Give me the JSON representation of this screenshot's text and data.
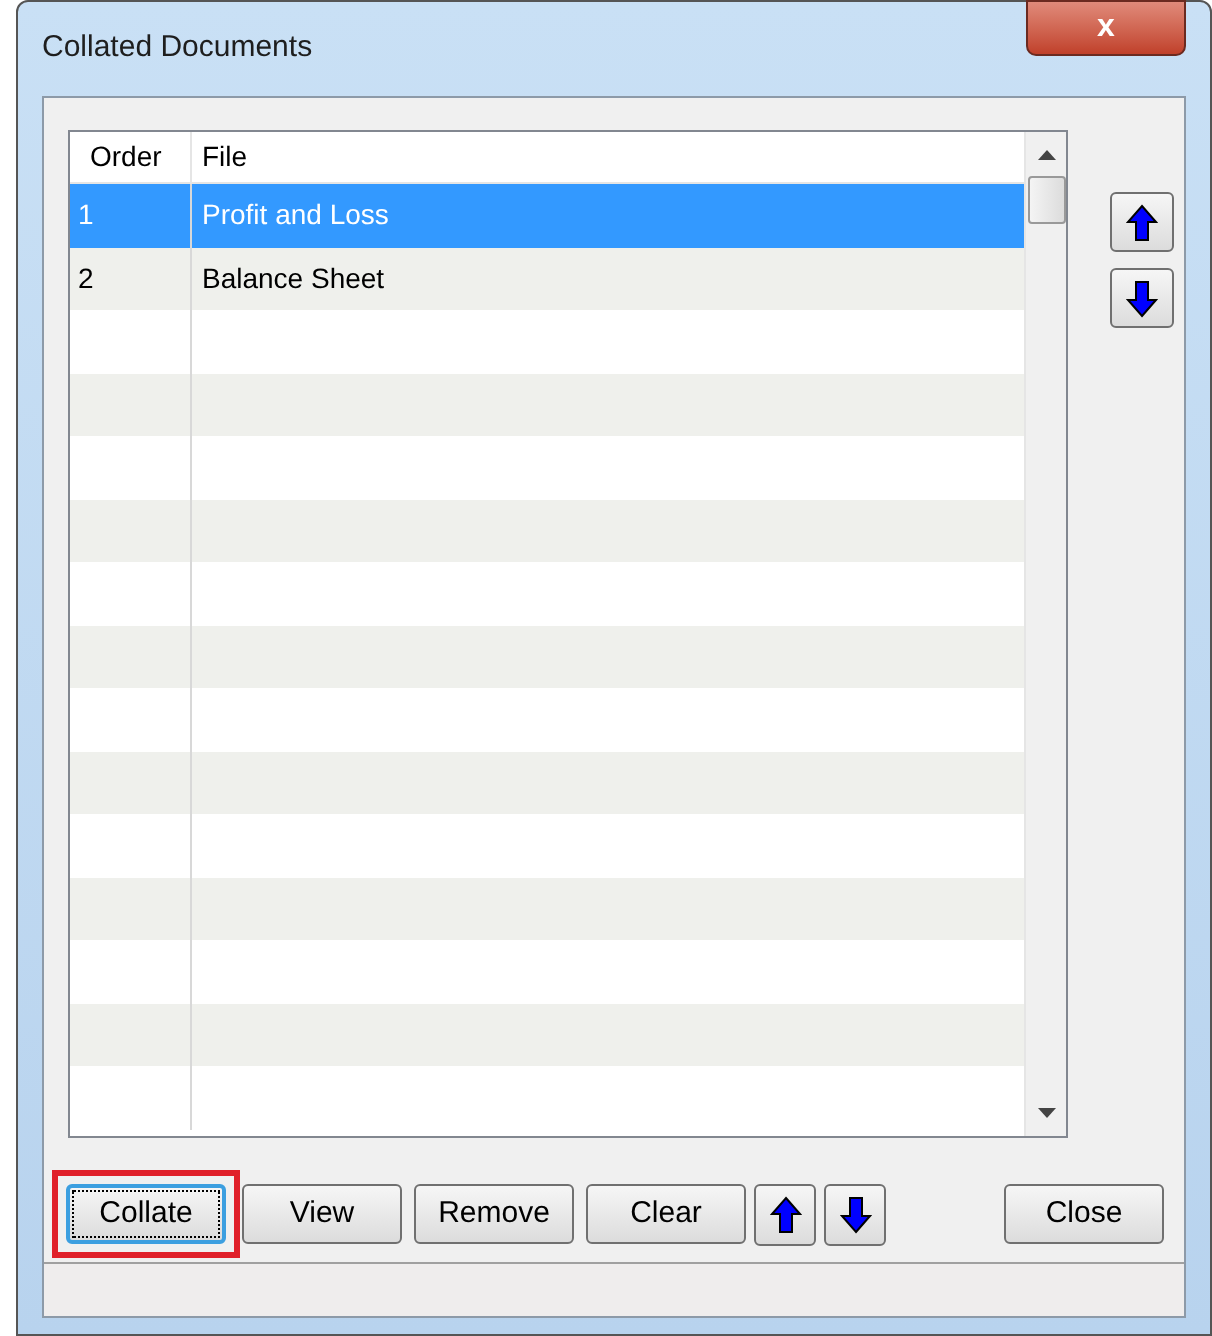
{
  "window": {
    "title": "Collated Documents",
    "close_symbol": "x"
  },
  "table": {
    "columns": [
      "Order",
      "File"
    ],
    "rows": [
      {
        "cells": [
          "1",
          "Profit and Loss"
        ],
        "selected": true
      },
      {
        "cells": [
          "2",
          "Balance Sheet"
        ],
        "selected": false
      }
    ]
  },
  "side_buttons": [
    {
      "kind": "up"
    },
    {
      "kind": "down"
    }
  ],
  "buttons": [
    {
      "kind": "text",
      "label": "Collate",
      "focused": true,
      "highlighted": true
    },
    {
      "kind": "text",
      "label": "View",
      "focused": false,
      "highlighted": false
    },
    {
      "kind": "text",
      "label": "Remove",
      "focused": false,
      "highlighted": false
    },
    {
      "kind": "text",
      "label": "Clear",
      "focused": false,
      "highlighted": false
    },
    {
      "kind": "up"
    },
    {
      "kind": "down"
    },
    {
      "kind": "spacer"
    },
    {
      "kind": "text",
      "label": "Close",
      "focused": false,
      "highlighted": false
    }
  ]
}
